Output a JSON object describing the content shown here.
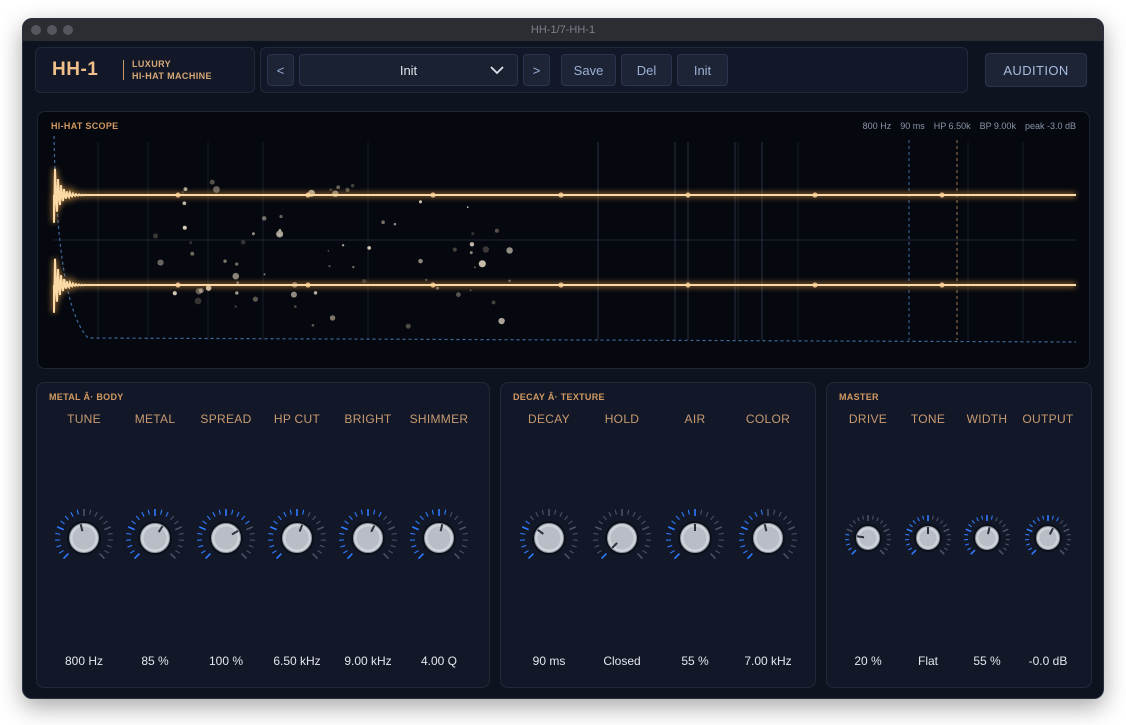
{
  "window": {
    "title": "HH-1/7-HH-1"
  },
  "logo": {
    "name": "HH-1",
    "line1": "LUXURY",
    "line2": "HI-HAT MACHINE"
  },
  "preset": {
    "prev_label": "<",
    "name": "Init",
    "next_label": ">",
    "save_label": "Save",
    "del_label": "Del",
    "init_label": "Init"
  },
  "audition_label": "AUDITION",
  "scope": {
    "title": "HI-HAT SCOPE",
    "stats": [
      "800 Hz",
      "90 ms",
      "HP 6.50k",
      "BP 9.00k",
      "peak -3.0 dB"
    ]
  },
  "panels": [
    {
      "title": "METAL Â· BODY",
      "knobs": [
        {
          "label": "TUNE",
          "value": "800 Hz",
          "level": 0.45
        },
        {
          "label": "METAL",
          "value": "85 %",
          "level": 0.62
        },
        {
          "label": "SPREAD",
          "value": "100 %",
          "level": 0.72
        },
        {
          "label": "HP CUT",
          "value": "6.50 kHz",
          "level": 0.58
        },
        {
          "label": "BRIGHT",
          "value": "9.00 kHz",
          "level": 0.6
        },
        {
          "label": "SHIMMER",
          "value": "4.00 Q",
          "level": 0.55
        }
      ]
    },
    {
      "title": "DECAY Â· TEXTURE",
      "knobs": [
        {
          "label": "DECAY",
          "value": "90 ms",
          "level": 0.3
        },
        {
          "label": "HOLD",
          "value": "Closed",
          "level": 0.0
        },
        {
          "label": "AIR",
          "value": "55 %",
          "level": 0.5
        },
        {
          "label": "COLOR",
          "value": "7.00 kHz",
          "level": 0.45
        }
      ]
    },
    {
      "title": "MASTER",
      "knobs": [
        {
          "label": "DRIVE",
          "value": "20 %",
          "level": 0.2
        },
        {
          "label": "TONE",
          "value": "Flat",
          "level": 0.5
        },
        {
          "label": "WIDTH",
          "value": "55 %",
          "level": 0.55
        },
        {
          "label": "OUTPUT",
          "value": "-0.0 dB",
          "level": 0.6
        }
      ]
    }
  ],
  "colors": {
    "accent": "#f0b870",
    "arc": "#2f7bff",
    "label": "#c89a72"
  }
}
